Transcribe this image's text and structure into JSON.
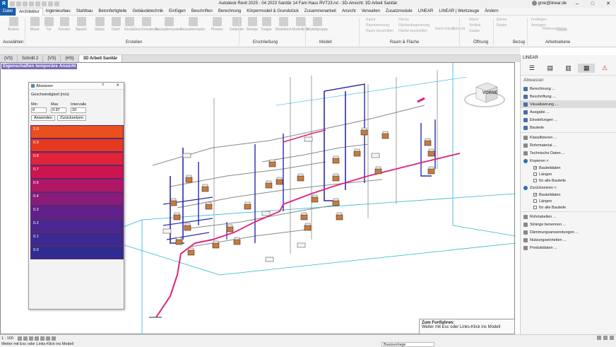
{
  "app": {
    "title": "Autodesk Revit 2025 - 04 2023 Sanitär 14 Fam Haus RVT23.rvt - 3D-Ansicht: 3D Arbeit Sanitär",
    "user": "gme@linear.de"
  },
  "menu": [
    "Datei",
    "Architektur",
    "Ingenieurbau",
    "Stahlbau",
    "Betonfertigteile",
    "Gebäudetechnik",
    "Einfügen",
    "Beschriften",
    "Berechnung",
    "Körpermodell & Grundstück",
    "Zusammenarbeit",
    "Ansicht",
    "Verwalten",
    "Zusatzmodule",
    "LINEAR",
    "LINEAR | Werkzeuge",
    "Ändern"
  ],
  "ribbon": {
    "buttons": [
      "Ändern",
      "Wand",
      "Tür",
      "Fenster",
      "Bauteil",
      "Stütze",
      "Dach",
      "Decke",
      "Geschossdecke",
      "Fassadensystem",
      "Fassadenraster",
      "Pfosten",
      "Geländer",
      "Rampe",
      "Treppe",
      "Modelltext",
      "Modelllinie",
      "Modellgruppe",
      "Raum",
      "Raumtrennung",
      "Raum beschriften",
      "Fläche",
      "Flächenbegrenzung",
      "Fläche beschriften",
      "Nach Fläche",
      "Schacht",
      "Wand",
      "Vertikal",
      "Gaube",
      "Ebene",
      "Raster",
      "Festlegen",
      "Anzeigen",
      "Referenzebene",
      "Viewer"
    ],
    "panels": [
      "Auswählen",
      "Erstellen",
      "Erschließung",
      "Modell",
      "Raum & Fläche",
      "Öffnung",
      "Bezug",
      "Arbeitsebene"
    ]
  },
  "tabs": [
    {
      "label": "{VS}"
    },
    {
      "label": "Schnitt 2"
    },
    {
      "label": "{VS}"
    },
    {
      "label": "{HS}"
    },
    {
      "label": "3D Arbeit Sanitär"
    }
  ],
  "viewport": {
    "label": "Eigenschaften temporäre Ansicht",
    "viewcube_face": "VORNE",
    "tooltip_title": "Zum Fortfahren:",
    "tooltip_text": "Weiter mit Esc oder Links-Klick ins Modell"
  },
  "dialog": {
    "title": "Abwasser",
    "help": "?",
    "close": "✕",
    "field_label": "Geschwindigkeit [m/s]",
    "min_label": "Min",
    "max_label": "Max",
    "interval_label": "Intervalle",
    "min_value": "0",
    "max_value": "0.97",
    "interval_value": "10",
    "apply": "Anwenden",
    "reset": "Zurücksetzen",
    "legend": [
      {
        "label": "1.0",
        "color": "#e8501e"
      },
      {
        "label": "0.9",
        "color": "#e53a1f"
      },
      {
        "label": "0.8",
        "color": "#e0243a"
      },
      {
        "label": "0.7",
        "color": "#cc1450"
      },
      {
        "label": "0.6",
        "color": "#b01866"
      },
      {
        "label": "0.4",
        "color": "#8a1c7c"
      },
      {
        "label": "0.3",
        "color": "#62208a"
      },
      {
        "label": "0.2",
        "color": "#4a2690"
      },
      {
        "label": "0.1",
        "color": "#3a2a92"
      },
      {
        "label": "0.0",
        "color": "#2e2c90"
      }
    ]
  },
  "panel": {
    "title": "LINEAR",
    "subtitle": "Abwasser",
    "items": [
      {
        "label": "Berechnung ...",
        "selected": false
      },
      {
        "label": "Beschriftung ...",
        "selected": false
      },
      {
        "label": "Visualisierung ...",
        "selected": true
      },
      {
        "label": "Ausgabe ...",
        "selected": false
      },
      {
        "label": "Einstellungen ...",
        "selected": false
      },
      {
        "label": "Bauteile",
        "selected": false
      }
    ],
    "items2": [
      "Klassifizieren ...",
      "Rohrmaterial ...",
      "Technische Daten ..."
    ],
    "copy_label": "Kopieren <",
    "copy_checks": [
      {
        "label": "Bauteildaten",
        "checked": true
      },
      {
        "label": "Längen",
        "checked": false
      },
      {
        "label": "für alle Bauteile",
        "checked": false
      }
    ],
    "reset_label": "Zurücksetzen <",
    "reset_checks": [
      {
        "label": "Bauteildaten",
        "checked": true
      },
      {
        "label": "Längen",
        "checked": false
      },
      {
        "label": "für alle Bauteile",
        "checked": false
      }
    ],
    "items3": [
      "Rohrtabellen ...",
      "Stränge benennen ...",
      "Dämmungsanwendungen ...",
      "Nutzungseinheiten ...",
      "Produktdaten ..."
    ]
  },
  "status": {
    "scale": "1 : 100",
    "message": "Weiter mit Esc oder Links-Klick ins Modell",
    "basis": "Basisvorlage"
  },
  "colors": {
    "accent": "#1c5ea8",
    "pipe_blue": "#2a2aa8",
    "pipe_pink": "#e0207a",
    "cyan": "#22b8d0"
  }
}
